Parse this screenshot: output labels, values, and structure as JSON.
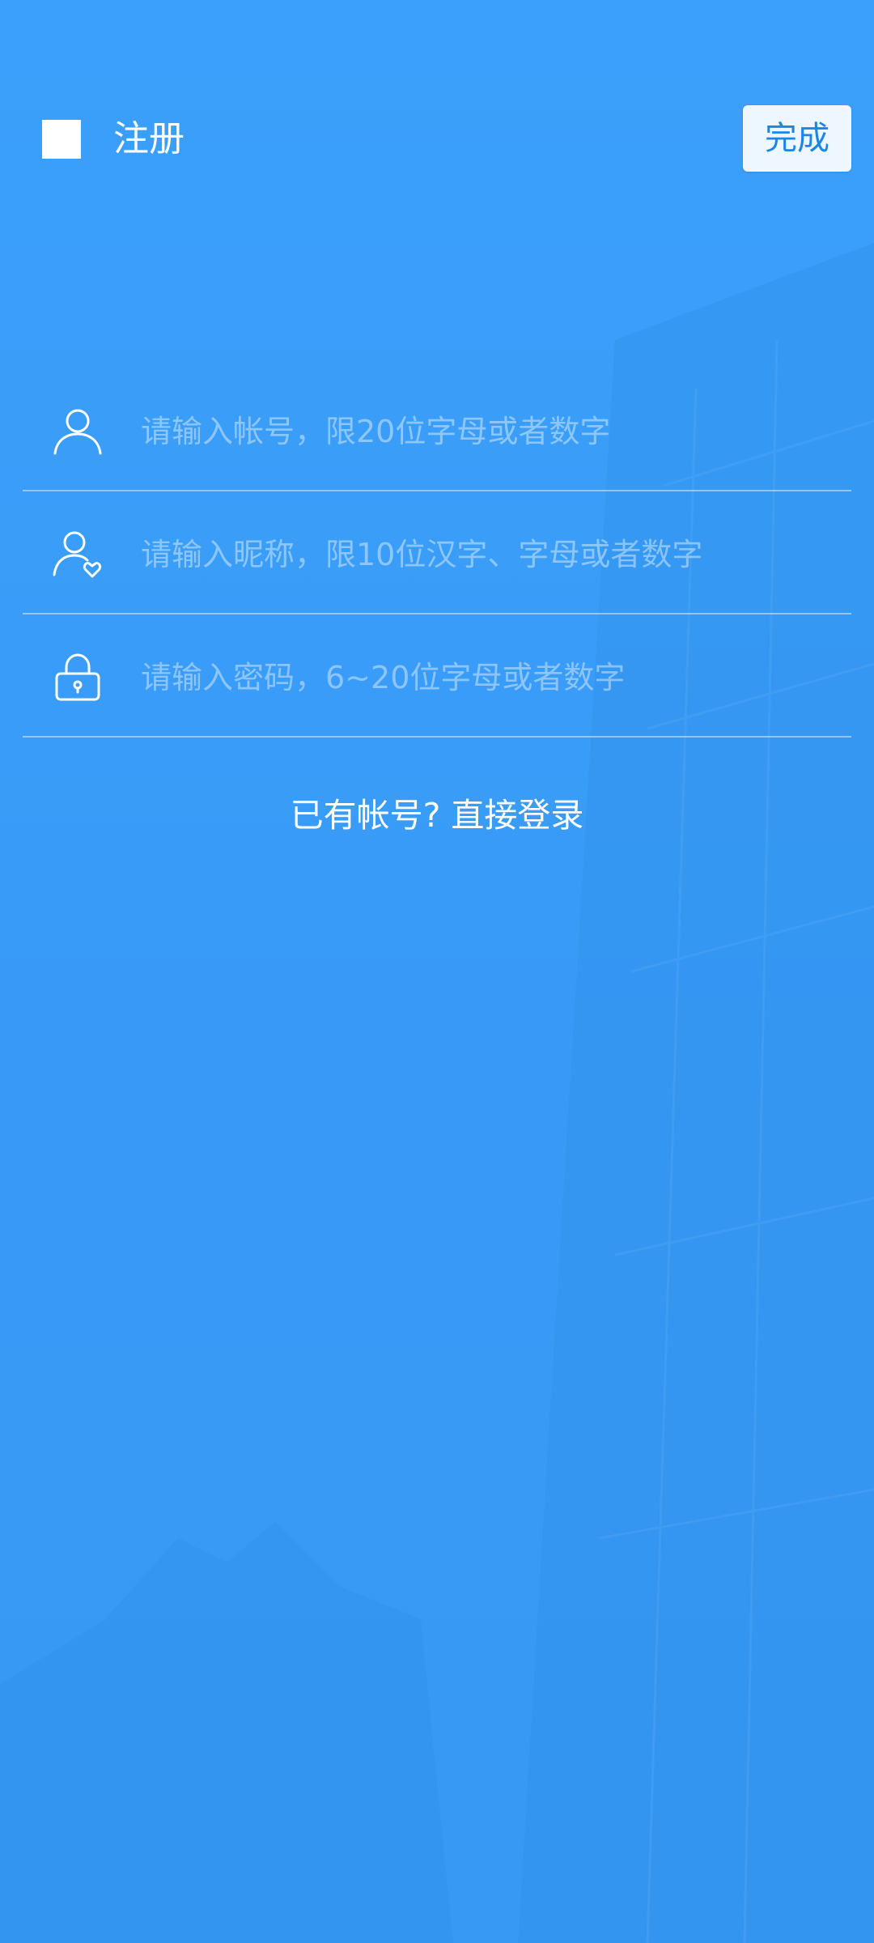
{
  "header": {
    "title": "注册",
    "done_label": "完成"
  },
  "form": {
    "fields": [
      {
        "name": "account",
        "icon": "user-icon",
        "placeholder": "请输入帐号，限20位字母或者数字",
        "value": ""
      },
      {
        "name": "nickname",
        "icon": "user-heart-icon",
        "placeholder": "请输入昵称，限10位汉字、字母或者数字",
        "value": ""
      },
      {
        "name": "password",
        "icon": "lock-icon",
        "placeholder": "请输入密码，6~20位字母或者数字",
        "value": ""
      }
    ]
  },
  "footer": {
    "login_prompt": "已有帐号?",
    "login_link": "直接登录"
  },
  "colors": {
    "background": "#3a9cf8",
    "done_button_bg": "#eef6ff",
    "done_button_text": "#1a86e6"
  }
}
